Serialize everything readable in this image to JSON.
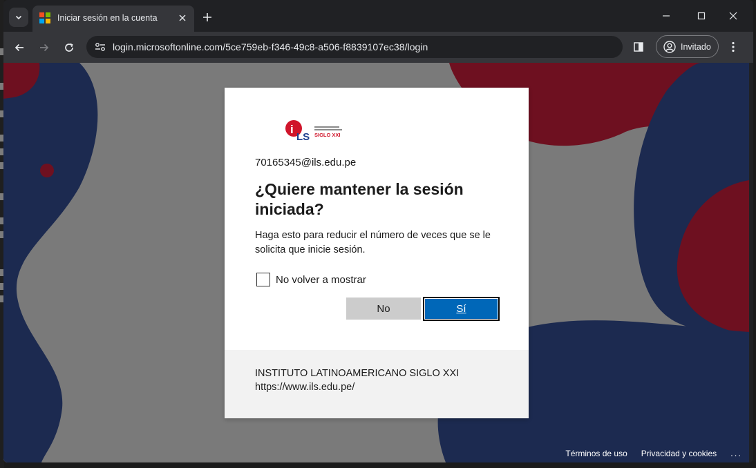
{
  "browser": {
    "tab": {
      "title": "Iniciar sesión en la cuenta"
    },
    "omnibox": {
      "url": "login.microsoftonline.com/5ce759eb-f346-49c8-a506-f8839107ec38/login"
    },
    "profile": {
      "label": "Invitado"
    }
  },
  "dialog": {
    "logo_text": "ILS",
    "logo_subtext": "SIGLO XXI",
    "identity": "70165345@ils.edu.pe",
    "title": "¿Quiere mantener la sesión iniciada?",
    "description": "Haga esto para reducir el número de veces que se le solicita que inicie sesión.",
    "checkbox_label": "No volver a mostrar",
    "checkbox_checked": false,
    "no_label": "No",
    "yes_label": "Sí",
    "footer": {
      "org": "INSTITUTO LATINOAMERICANO SIGLO XXI",
      "link": "https://www.ils.edu.pe/"
    }
  },
  "page_footer": {
    "terms": "Términos de uso",
    "privacy": "Privacidad y cookies",
    "more": "..."
  },
  "colors": {
    "primary_button": "#0067b8",
    "bg_navy": "#1c2a50",
    "bg_red": "#6e1020",
    "bg_gray": "#7a7a7a"
  }
}
